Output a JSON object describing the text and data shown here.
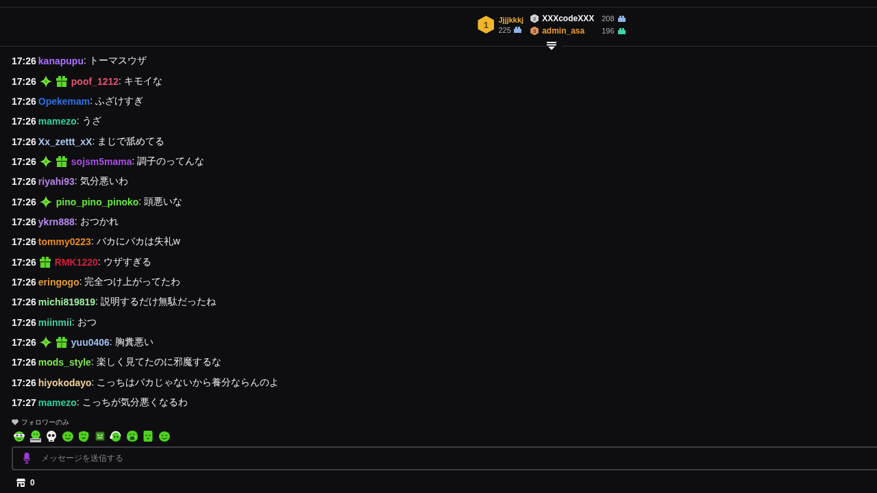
{
  "leaderboard": [
    {
      "rank": "1",
      "name": "Jjjjkkkj",
      "color": "#e8b23c",
      "score": "225",
      "gift": {
        "color": "#8cb4e6"
      }
    },
    {
      "rank": "2",
      "name": "XXXcodeXXX",
      "color": "#f4f4f6",
      "score": "208",
      "gift": {
        "color": "#8cb4e6"
      }
    },
    {
      "rank": "3",
      "name": "admin_asa",
      "color": "#e89a2e",
      "score": "196",
      "gift": {
        "color": "#3fd6a6"
      }
    }
  ],
  "chat": {
    "messages": [
      {
        "time": "17:26",
        "user": "kanapupu",
        "color": "#a970ff",
        "text": ": トーマスウザ"
      },
      {
        "time": "17:26",
        "badges": [
          {
            "kind": "sparkle"
          },
          {
            "kind": "gift"
          }
        ],
        "user": "poof_1212",
        "color": "#e2526e",
        "text": ": キモイな"
      },
      {
        "time": "17:26",
        "user": "Opekemam",
        "color": "#2c6fe0",
        "text": ": ふざけすぎ"
      },
      {
        "time": "17:26",
        "user": "mamezo",
        "color": "#2ecf9a",
        "text": ": うざ"
      },
      {
        "time": "17:26",
        "user": "Xx_zettt_xX",
        "color": "#a9c6f0",
        "text": ": まじで舐めてる"
      },
      {
        "time": "17:26",
        "badges": [
          {
            "kind": "sparkle"
          },
          {
            "kind": "gift"
          }
        ],
        "user": "sojsm5mama",
        "color": "#a94de8",
        "text": ": 調子のってんな"
      },
      {
        "time": "17:26",
        "user": "riyahi93",
        "color": "#b982ec",
        "text": ": 気分悪いわ"
      },
      {
        "time": "17:26",
        "badges": [
          {
            "kind": "sparkle"
          }
        ],
        "user": "pino_pino_pinoko",
        "color": "#63e83a",
        "text": ": 頭悪いな"
      },
      {
        "time": "17:26",
        "user": "ykrn888",
        "color": "#b98af5",
        "text": ": おつかれ"
      },
      {
        "time": "17:26",
        "user": "tommy0223",
        "color": "#e8891e",
        "text": ": バカにバカは失礼w"
      },
      {
        "time": "17:26",
        "badges": [
          {
            "kind": "gift"
          }
        ],
        "user": "RMK1220",
        "color": "#d21f3c",
        "text": ": ウザすぎる"
      },
      {
        "time": "17:26",
        "user": "eringogo",
        "color": "#e69a30",
        "text": ": 完全つけ上がってたわ"
      },
      {
        "time": "17:26",
        "user": "michi819819",
        "color": "#9cf0a0",
        "text": ": 説明するだけ無駄だったね"
      },
      {
        "time": "17:26",
        "user": "miinmii",
        "color": "#40d0a0",
        "text": ": おつ"
      },
      {
        "time": "17:26",
        "badges": [
          {
            "kind": "sparkle"
          },
          {
            "kind": "gift"
          }
        ],
        "user": "yuu0406",
        "color": "#9ebef0",
        "text": ": 胸糞悪い"
      },
      {
        "time": "17:26",
        "user": "mods_style",
        "color": "#7fe84c",
        "text": ": 楽しく見てたのに邪魔するな"
      },
      {
        "time": "17:26",
        "user": "hiyokodayo",
        "color": "#f0cf97",
        "text": ": こっちはバカじゃないから養分ならんのよ"
      },
      {
        "time": "17:27",
        "user": "mamezo",
        "color": "#2ecf9a",
        "text": ": こっちが気分悪くなるわ"
      }
    ]
  },
  "chat_mode": {
    "label": "フォロワーのみ"
  },
  "emotes": [
    {
      "kind": "glasses"
    },
    {
      "kind": "laptop"
    },
    {
      "kind": "skull"
    },
    {
      "kind": "blob"
    },
    {
      "kind": "grin"
    },
    {
      "kind": "crate"
    },
    {
      "kind": "headset"
    },
    {
      "kind": "crying"
    },
    {
      "kind": "tile"
    },
    {
      "kind": "blob"
    }
  ],
  "message_input": {
    "placeholder": "メッセージを送信する"
  },
  "points": {
    "balance": "0"
  }
}
